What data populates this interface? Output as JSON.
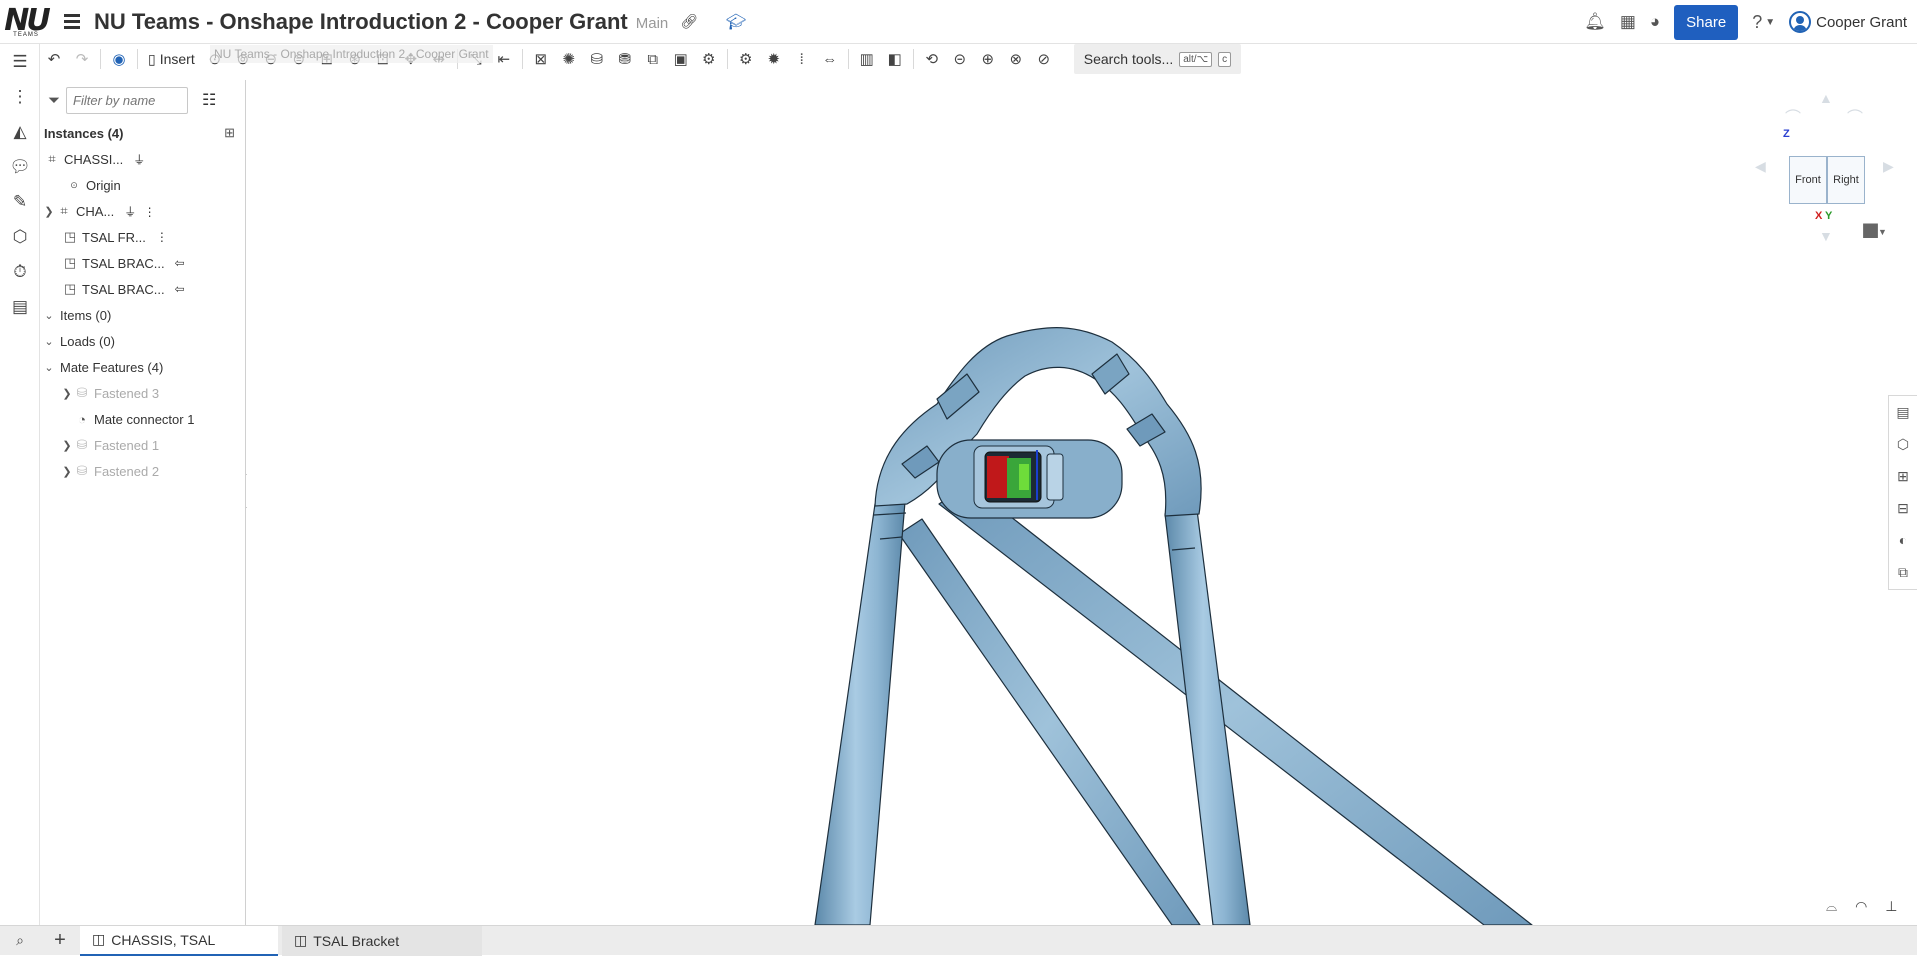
{
  "header": {
    "logo_text": "NU",
    "logo_sub": "TEAMS",
    "title": "NU Teams - Onshape Introduction 2 - Cooper Grant",
    "branch": "Main",
    "share_label": "Share",
    "user_name": "Cooper Grant"
  },
  "toolbar": {
    "insert_label": "Insert",
    "ghost_tooltip": "NU Teams - Onshape Introduction 2 - Cooper Grant",
    "search_label": "Search tools...",
    "search_key1": "alt/⌥",
    "search_key2": "c"
  },
  "panel": {
    "filter_placeholder": "Filter by name",
    "instances_label": "Instances (4)",
    "instances": [
      {
        "label": "CHASSI...",
        "extra": "⏚"
      },
      {
        "label": "Origin"
      },
      {
        "label": "CHA...",
        "extra": "⏚ ⋮"
      },
      {
        "label": "TSAL FR...",
        "extra": "⋮"
      },
      {
        "label": "TSAL BRAC...",
        "extra": "⇦"
      },
      {
        "label": "TSAL BRAC...",
        "extra": "⇦"
      }
    ],
    "items_label": "Items (0)",
    "loads_label": "Loads (0)",
    "mates_label": "Mate Features (4)",
    "mates": [
      {
        "label": "Fastened 3"
      },
      {
        "label": "Mate connector 1"
      },
      {
        "label": "Fastened 1"
      },
      {
        "label": "Fastened 2"
      }
    ]
  },
  "viewcube": {
    "front": "Front",
    "right": "Right",
    "axis_z": "Z",
    "axis_x": "X",
    "axis_y": "Y"
  },
  "tabs": [
    {
      "label": "CHASSIS, TSAL"
    },
    {
      "label": "TSAL Bracket"
    }
  ],
  "colors": {
    "accent": "#1f5fbf",
    "tube": "#7fa7c4",
    "tube_dark": "#4f7d9e"
  }
}
